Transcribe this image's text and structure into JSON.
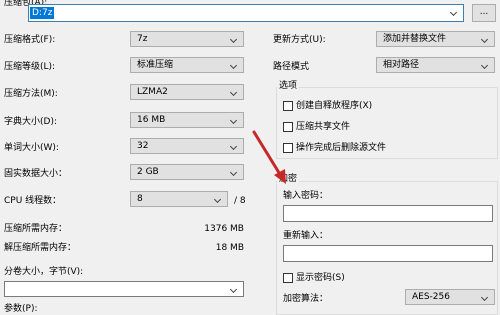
{
  "archive": {
    "label": "压缩包(A):",
    "value": "D:7z",
    "browse_label": "..."
  },
  "left": {
    "format": {
      "label": "压缩格式(F):",
      "value": "7z"
    },
    "level": {
      "label": "压缩等级(L):",
      "value": "标准压缩"
    },
    "method": {
      "label": "压缩方法(M):",
      "value": "LZMA2"
    },
    "dict": {
      "label": "字典大小(D):",
      "value": "16 MB"
    },
    "word": {
      "label": "单词大小(W):",
      "value": "32"
    },
    "solid": {
      "label": "固实数据大小：",
      "value": "2 GB"
    },
    "threads": {
      "label": "CPU 线程数：",
      "value": "8",
      "max": "/ 8"
    },
    "mem_compress": {
      "label": "压缩所需内存：",
      "value": "1376 MB"
    },
    "mem_decompress": {
      "label": "解压缩所需内存：",
      "value": "18 MB"
    },
    "split": {
      "label": "分卷大小，字节(V):",
      "value": ""
    },
    "params": {
      "label": "参数(P):"
    }
  },
  "right": {
    "update": {
      "label": "更新方式(U):",
      "value": "添加并替换文件"
    },
    "path": {
      "label": "路径模式",
      "value": "相对路径"
    },
    "options": {
      "title": "选项",
      "sfx": "创建自释放程序(X)",
      "shared": "压缩共享文件",
      "delete": "操作完成后删除源文件"
    },
    "encrypt": {
      "title": "加密",
      "password_label": "输入密码：",
      "reenter_label": "重新输入：",
      "show_password": "显示密码(S)",
      "method_label": "加密算法：",
      "method_value": "AES-256"
    }
  },
  "colors": {
    "arrow": "#c62828",
    "background": "#f0f0f0"
  }
}
